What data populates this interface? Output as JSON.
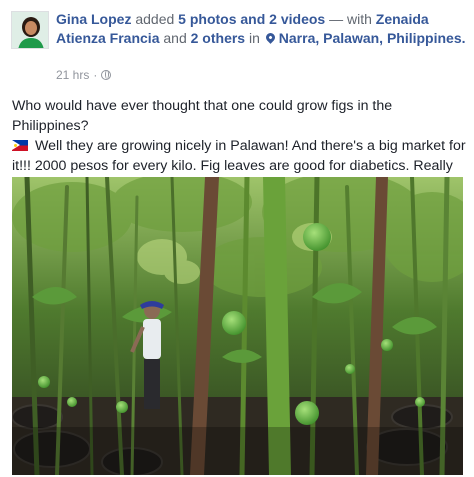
{
  "post": {
    "author": "Gina Lopez",
    "action_prefix": "added",
    "media_summary": "5 photos and 2 videos",
    "with_text": "— with",
    "tagged_person": "Zenaida Atienza Francia",
    "and_text": "and",
    "others_link": "2 others",
    "in_text": "in",
    "location": "Narra, Palawan, Philippines.",
    "timestamp": "21 hrs",
    "dot": "·",
    "privacy_icon": "globe-icon",
    "location_icon": "location-pin-icon",
    "text_line1": "Who would have ever thought that one could grow figs in the Philippines?",
    "text_body": "Well they are growing nicely in Palawan! And there's a big market for it!!! 2000 pesos for every kilo. Fig leaves are good for diabetics. Really biiiig economic potential!!!",
    "flag_icon": "philippines-flag-icon",
    "laugh_emoji": "😆",
    "heart_emoji": "❤",
    "photo_description_icon": "fig-plantation-photo"
  },
  "colors": {
    "link": "#365899",
    "meta": "#90949c",
    "text": "#1d2129",
    "heart": "#e0245e",
    "laugh": "#f0b400"
  }
}
